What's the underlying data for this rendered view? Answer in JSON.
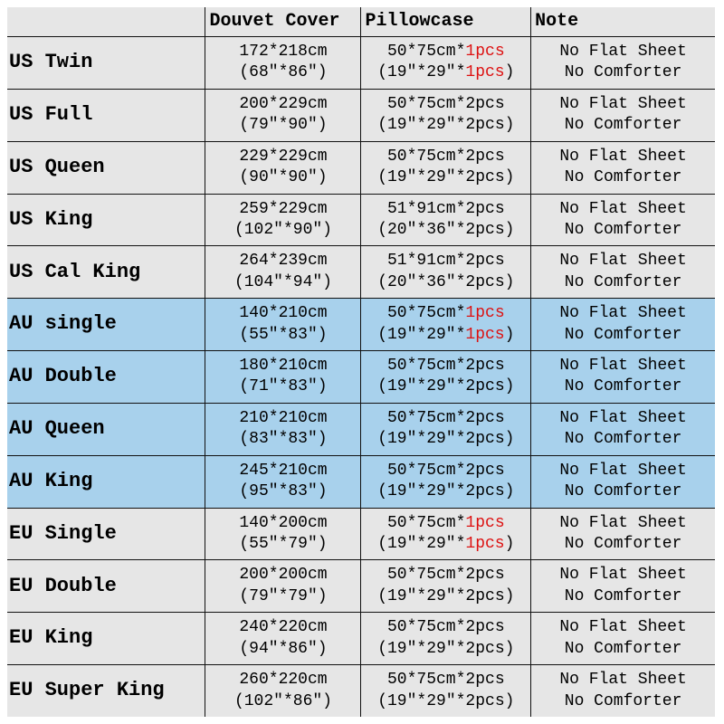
{
  "headers": {
    "size": "",
    "duvet": "Douvet Cover",
    "pillow": "Pillowcase",
    "note": "Note"
  },
  "note_lines": [
    "No Flat Sheet",
    "No Comforter"
  ],
  "rows": [
    {
      "size": "US Twin",
      "region": "us",
      "duvet": [
        "172*218cm",
        "(68″*86″)"
      ],
      "pillow": [
        [
          "50*75cm*",
          {
            "r": "1pcs"
          }
        ],
        [
          "(19″*29″*",
          {
            "r": "1pcs"
          },
          ")"
        ]
      ]
    },
    {
      "size": "US Full",
      "region": "us",
      "duvet": [
        "200*229cm",
        "(79″*90″)"
      ],
      "pillow": [
        [
          "50*75cm*2pcs"
        ],
        [
          "(19″*29″*2pcs)"
        ]
      ]
    },
    {
      "size": "US Queen",
      "region": "us",
      "duvet": [
        "229*229cm",
        "(90″*90″)"
      ],
      "pillow": [
        [
          "50*75cm*2pcs"
        ],
        [
          "(19″*29″*2pcs)"
        ]
      ]
    },
    {
      "size": "US King",
      "region": "us",
      "duvet": [
        "259*229cm",
        "(102″*90″)"
      ],
      "pillow": [
        [
          "51*91cm*2pcs"
        ],
        [
          "(20″*36″*2pcs)"
        ]
      ]
    },
    {
      "size": "US Cal King",
      "region": "us",
      "duvet": [
        "264*239cm",
        "(104″*94″)"
      ],
      "pillow": [
        [
          "51*91cm*2pcs"
        ],
        [
          "(20″*36″*2pcs)"
        ]
      ]
    },
    {
      "size": "AU single",
      "region": "au",
      "duvet": [
        "140*210cm",
        "(55″*83″)"
      ],
      "pillow": [
        [
          "50*75cm*",
          {
            "r": "1pcs"
          }
        ],
        [
          "(19″*29″*",
          {
            "r": "1pcs"
          },
          ")"
        ]
      ]
    },
    {
      "size": "AU Double",
      "region": "au",
      "duvet": [
        "180*210cm",
        "(71″*83″)"
      ],
      "pillow": [
        [
          "50*75cm*2pcs"
        ],
        [
          "(19″*29″*2pcs)"
        ]
      ]
    },
    {
      "size": "AU Queen",
      "region": "au",
      "duvet": [
        "210*210cm",
        "(83″*83″)"
      ],
      "pillow": [
        [
          "50*75cm*2pcs"
        ],
        [
          "(19″*29″*2pcs)"
        ]
      ]
    },
    {
      "size": "AU King",
      "region": "au",
      "duvet": [
        "245*210cm",
        "(95″*83″)"
      ],
      "pillow": [
        [
          "50*75cm*2pcs"
        ],
        [
          "(19″*29″*2pcs)"
        ]
      ]
    },
    {
      "size": "EU Single",
      "region": "eu",
      "duvet": [
        "140*200cm",
        "(55″*79″)"
      ],
      "pillow": [
        [
          "50*75cm*",
          {
            "r": "1pcs"
          }
        ],
        [
          "(19″*29″*",
          {
            "r": "1pcs"
          },
          ")"
        ]
      ]
    },
    {
      "size": "EU Double",
      "region": "eu",
      "duvet": [
        "200*200cm",
        "(79″*79″)"
      ],
      "pillow": [
        [
          "50*75cm*2pcs"
        ],
        [
          "(19″*29″*2pcs)"
        ]
      ]
    },
    {
      "size": "EU King",
      "region": "eu",
      "duvet": [
        "240*220cm",
        "(94″*86″)"
      ],
      "pillow": [
        [
          "50*75cm*2pcs"
        ],
        [
          "(19″*29″*2pcs)"
        ]
      ]
    },
    {
      "size": "EU Super King",
      "region": "eu",
      "duvet": [
        "260*220cm",
        "(102″*86″)"
      ],
      "pillow": [
        [
          "50*75cm*2pcs"
        ],
        [
          "(19″*29″*2pcs)"
        ]
      ]
    }
  ]
}
